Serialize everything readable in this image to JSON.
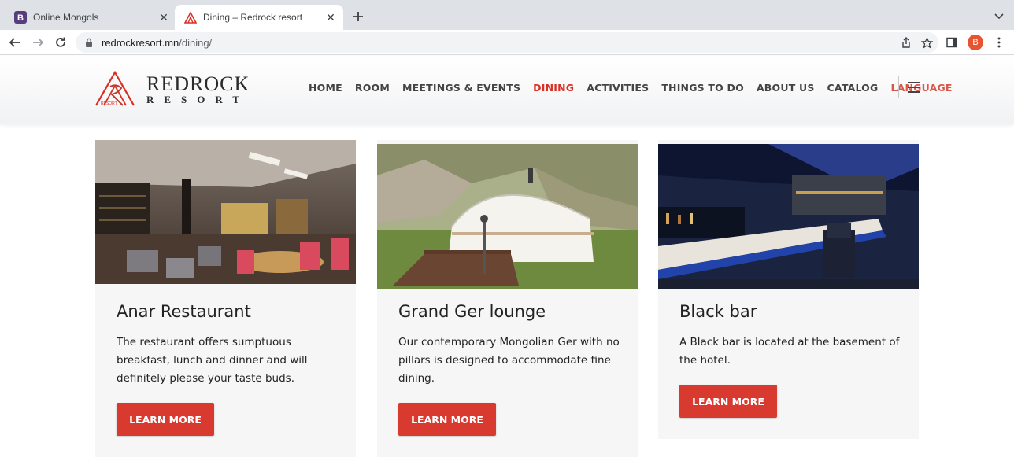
{
  "browser": {
    "tabs": [
      {
        "title": "Online Mongols",
        "favicon": "bootstrap-icon",
        "active": false
      },
      {
        "title": "Dining – Redrock resort",
        "favicon": "redrock-icon",
        "active": true
      }
    ],
    "url_host": "redrockresort.mn",
    "url_path": "/dining/",
    "profile_initial": "B"
  },
  "site": {
    "logo_name": "REDROCK",
    "logo_sub": "RESORT",
    "logo_mark_text": "RESORT",
    "brand_color": "#d93025",
    "nav": [
      {
        "label": "HOME"
      },
      {
        "label": "ROOM"
      },
      {
        "label": "MEETINGS & EVENTS"
      },
      {
        "label": "DINING",
        "active": true
      },
      {
        "label": "ACTIVITIES"
      },
      {
        "label": "THINGS TO DO"
      },
      {
        "label": "ABOUT US"
      },
      {
        "label": "CATALOG"
      },
      {
        "label": "LANGUAGE"
      }
    ]
  },
  "cards": [
    {
      "title": "Anar Restaurant",
      "description": "The restaurant offers sumptuous breakfast, lunch and dinner and will definitely please your taste buds.",
      "button": "LEARN MORE",
      "image": "restaurant-interior"
    },
    {
      "title": "Grand Ger lounge",
      "description": "Our contemporary Mongolian Ger with no pillars is designed to accommodate fine dining.",
      "button": "LEARN MORE",
      "image": "mongolian-ger"
    },
    {
      "title": "Black bar",
      "description": "A Black bar is located at the basement of the hotel.",
      "button": "LEARN MORE",
      "image": "bar-interior"
    }
  ]
}
